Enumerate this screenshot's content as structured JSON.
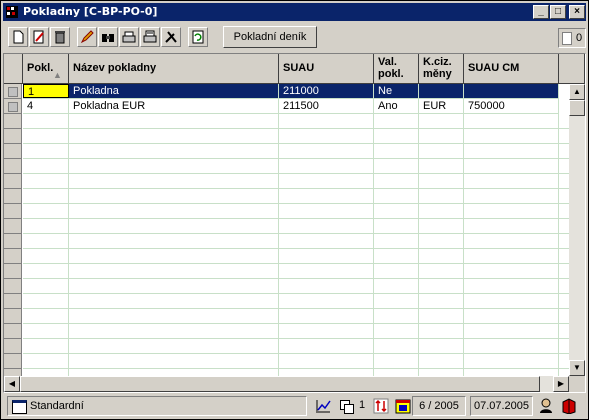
{
  "window": {
    "title": "Pokladny [C-BP-PO-0]",
    "controls": {
      "minimize": "_",
      "maximize": "□",
      "close": "×"
    }
  },
  "toolbar": {
    "icons": [
      "new-document-icon",
      "edit-icon",
      "delete-icon",
      "pencil-icon",
      "find-icon",
      "print-icon",
      "print-setup-icon",
      "tools-icon",
      "refresh-icon"
    ],
    "journal_button": "Pokladní deník",
    "record_count": "0"
  },
  "table": {
    "columns": [
      "Pokl.",
      "Název pokladny",
      "SUAU",
      "Val. pokl.",
      "K.ciz. měny",
      "SUAU CM"
    ],
    "rows": [
      {
        "pokl": "1",
        "nazev": "Pokladna",
        "suau": "211000",
        "val": "Ne",
        "kciz": "",
        "suaucm": ""
      },
      {
        "pokl": "4",
        "nazev": "Pokladna EUR",
        "suau": "211500",
        "val": "Ano",
        "kciz": "EUR",
        "suaucm": "750000"
      }
    ],
    "selected_row": 0,
    "colors": {
      "selection": "#0a246a",
      "current_cell": "#ffff00",
      "grid_line": "#c8e0c8"
    }
  },
  "statusbar": {
    "layout": "Standardní",
    "page": "1",
    "period": "6 / 2005",
    "date": "07.07.2005"
  }
}
